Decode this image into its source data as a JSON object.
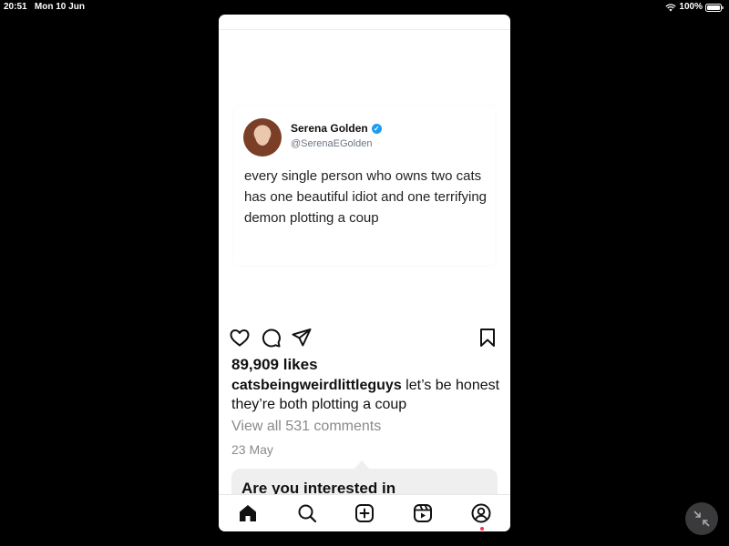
{
  "status_bar": {
    "time": "20:51",
    "date": "Mon 10 Jun",
    "battery": "100%"
  },
  "tweet": {
    "name": "Serena Golden",
    "handle": "@SerenaEGolden",
    "text": "every single person who owns two cats has one beautiful idiot and one terrifying demon plotting a coup"
  },
  "post": {
    "likes": "89,909 likes",
    "username": "catsbeingweirdlittleguys",
    "caption": "let’s be honest they’re both plotting a coup",
    "view_comments": "View all 531 comments",
    "date": "23 May"
  },
  "suggestion": {
    "title": "Are you interested in"
  },
  "icons": {
    "like": "heart-icon",
    "comment": "comment-icon",
    "share": "send-icon",
    "save": "bookmark-icon",
    "home": "home-icon",
    "search": "search-icon",
    "create": "plus-square-icon",
    "reels": "reels-icon",
    "profile": "profile-icon"
  },
  "colors": {
    "verified": "#1d9bf0",
    "notification_dot": "#ff2d55"
  }
}
